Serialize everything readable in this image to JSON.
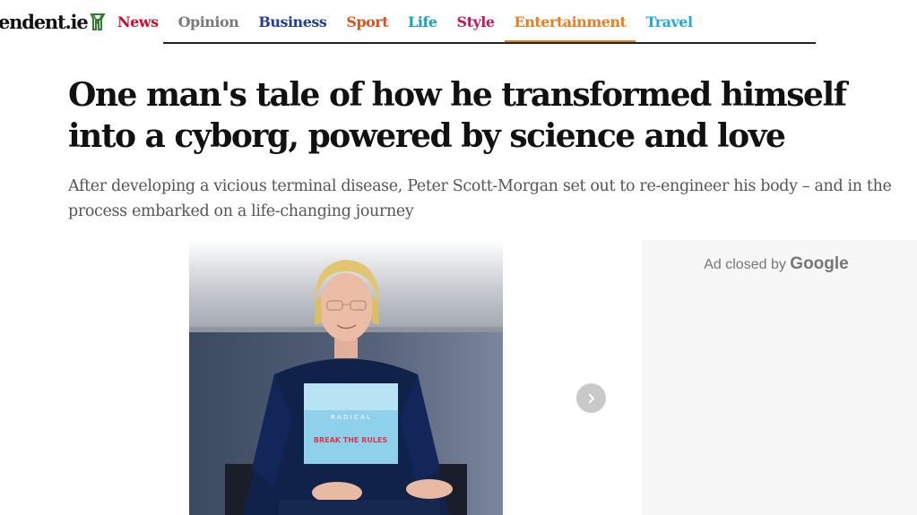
{
  "header": {
    "brand": "endent.ie",
    "brand_icon": "harp-icon",
    "brand_icon_color": "#2e7d32",
    "nav": [
      {
        "label": "News",
        "color": "#c8102e"
      },
      {
        "label": "Opinion",
        "color": "#7a7a7a"
      },
      {
        "label": "Business",
        "color": "#1f3f8f"
      },
      {
        "label": "Sport",
        "color": "#d9531e"
      },
      {
        "label": "Life",
        "color": "#17a2b8"
      },
      {
        "label": "Style",
        "color": "#c2185b"
      },
      {
        "label": "Entertainment",
        "color": "#e67e22",
        "active": true
      },
      {
        "label": "Travel",
        "color": "#29a8d8"
      }
    ]
  },
  "article": {
    "headline": "One man's tale of how he transformed himself into a cyborg, powered by science and love",
    "standfirst": "After developing a vicious terminal disease, Peter Scott-Morgan set out to re-engineer his body – and in the process embarked on a life-changing journey",
    "photo_shirt_text_top": "R A D I C A L",
    "photo_shirt_text_bottom": "BREAK THE RULES",
    "next_icon": "chevron-right-icon"
  },
  "ad": {
    "closed_text": "Ad closed by",
    "brand": "Google"
  }
}
